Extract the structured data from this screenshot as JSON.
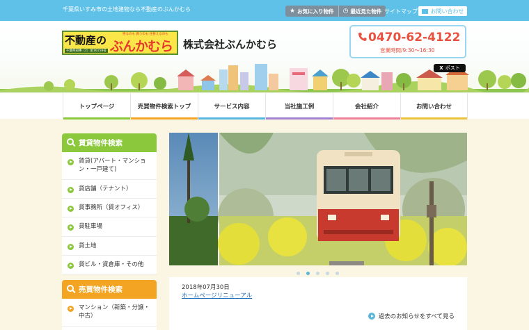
{
  "header": {
    "tagline": "千葉県いすみ市の土地建物なら不動産のぶんかむら",
    "favorites": "お気に入り物件",
    "recent": "最近見た物件",
    "sitemap": "サイトマップ",
    "contact": "お問い合わせ",
    "tweet": "ポスト"
  },
  "logo": {
    "main": "不動産の",
    "kana": "ぶんかむら",
    "small": "売るのも 買うのも 住替えるのも",
    "license": "千葉県知事（2）第16158号"
  },
  "company": "株式会社ぶんかむら",
  "phone": {
    "number": "0470-62-4122",
    "hours": "営業時間/9:30〜16:30"
  },
  "nav": [
    {
      "label": "トップページ",
      "color": "#8cc83c"
    },
    {
      "label": "売買物件検索トップ",
      "color": "#f2a422"
    },
    {
      "label": "サービス内容",
      "color": "#56b7e0"
    },
    {
      "label": "当社施工例",
      "color": "#a37fd0"
    },
    {
      "label": "会社紹介",
      "color": "#f07f9a"
    },
    {
      "label": "お問い合わせ",
      "color": "#e9c43a"
    }
  ],
  "rental": {
    "heading": "賃貸物件検索",
    "color": "#8cc83c",
    "items": [
      "賃貸(アパート・マンション・一戸建て)",
      "貸店舗（テナント）",
      "貸事務所（貸オフィス）",
      "貸駐車場",
      "貸土地",
      "貸ビル・貸倉庫・その他"
    ]
  },
  "sale": {
    "heading": "売買物件検索",
    "color": "#f2a422",
    "items": [
      "マンション（新築・分譲・中古）"
    ]
  },
  "slider": {
    "count": 5,
    "active": 1
  },
  "news": {
    "date": "2018年07月30日",
    "title": "ホームページリニューアル",
    "more": "過去のお知らせをすべて見る"
  },
  "colors": {
    "topbar": "#5fc1e7",
    "accent_red": "#e8523f",
    "link": "#1e6bb8"
  }
}
